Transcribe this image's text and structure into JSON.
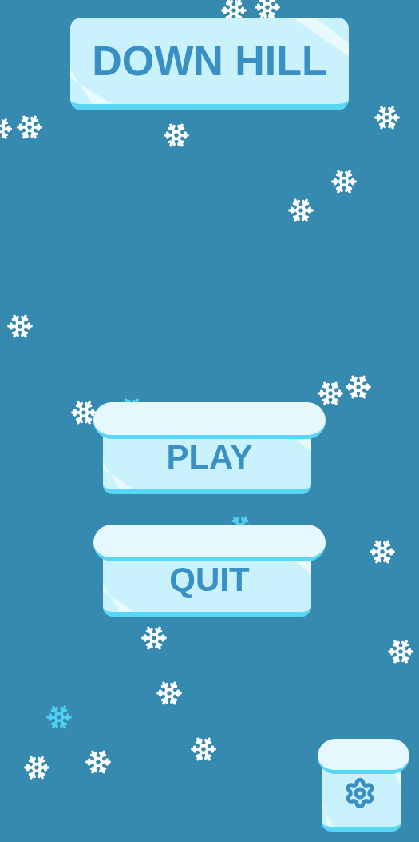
{
  "title": "DOWN HILL",
  "menu": [
    {
      "label": "PLAY"
    },
    {
      "label": "QUIT"
    }
  ]
}
